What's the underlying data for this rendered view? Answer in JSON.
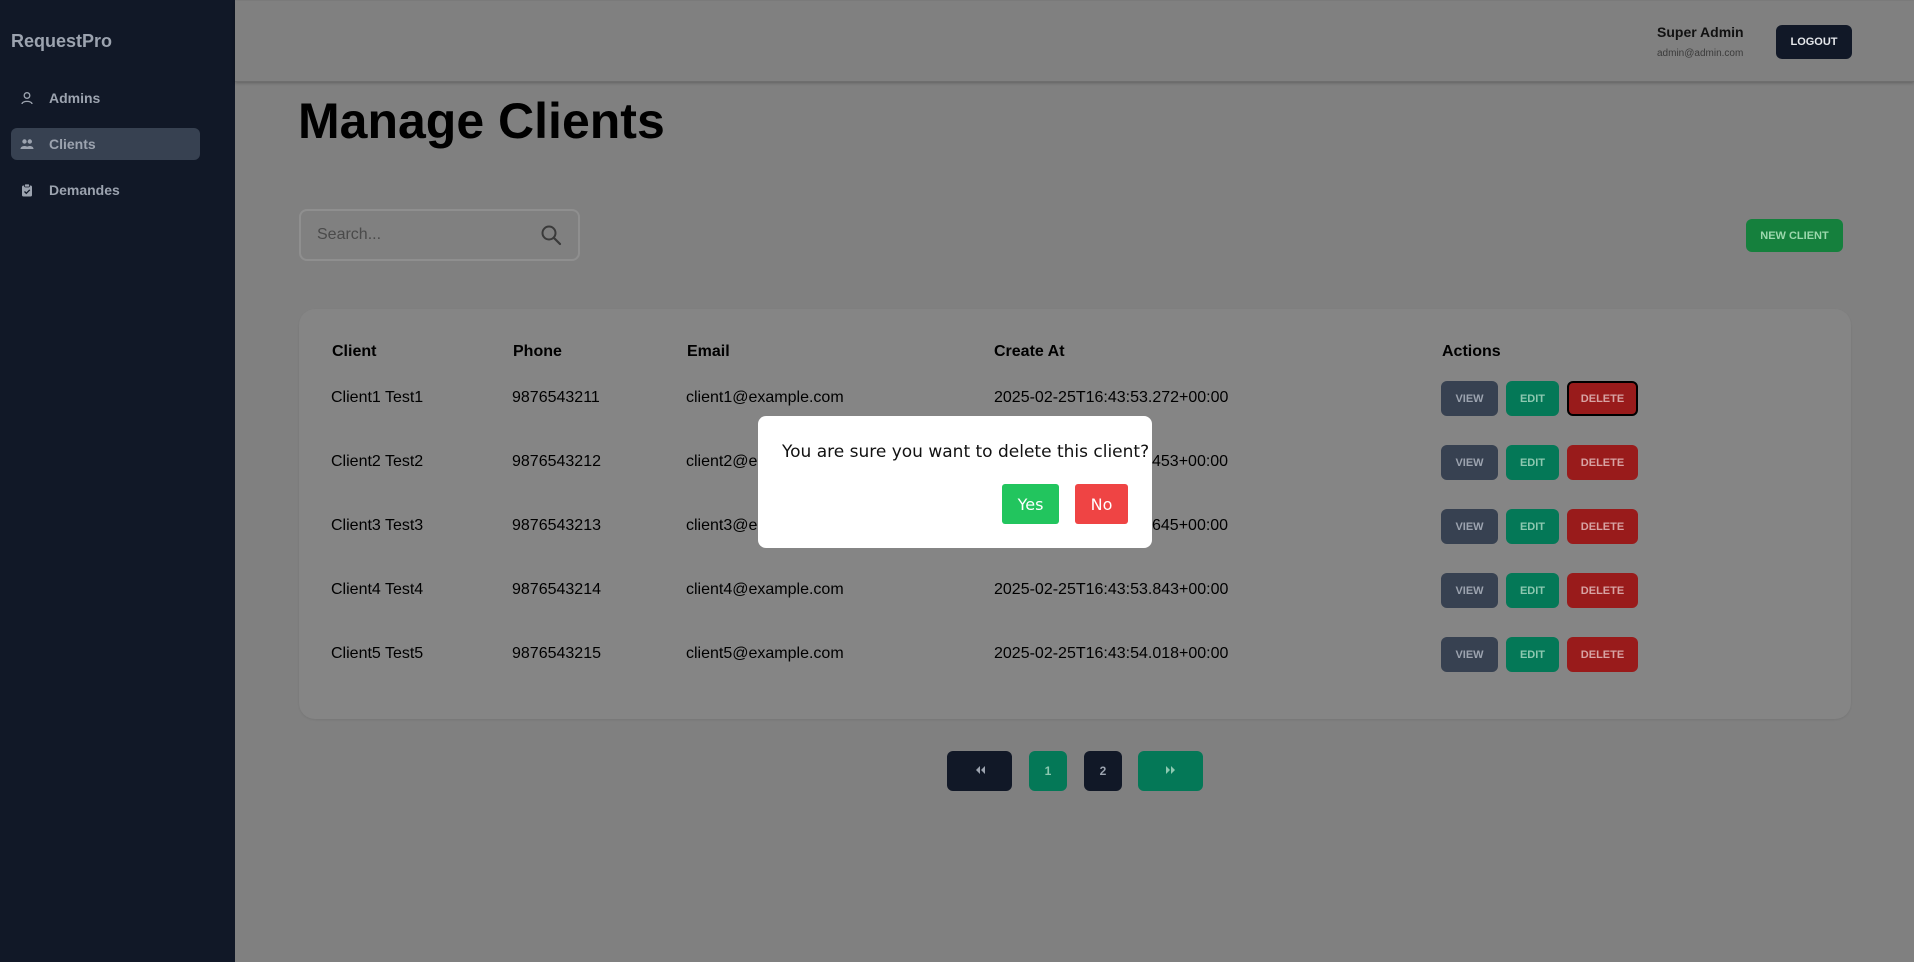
{
  "sidebar": {
    "brand": "RequestPro",
    "items": [
      {
        "label": "Admins",
        "icon": "user-icon",
        "active": false
      },
      {
        "label": "Clients",
        "icon": "users-icon",
        "active": true
      },
      {
        "label": "Demandes",
        "icon": "clipboard-icon",
        "active": false
      }
    ]
  },
  "header": {
    "user_name": "Super Admin",
    "user_email": "admin@admin.com",
    "logout_label": "LOGOUT"
  },
  "main": {
    "title": "Manage Clients",
    "search_placeholder": "Search...",
    "new_client_label": "NEW CLIENT"
  },
  "table": {
    "headers": [
      "Client",
      "Phone",
      "Email",
      "Create At",
      "Actions"
    ],
    "rows": [
      {
        "client": "Client1 Test1",
        "phone": "9876543211",
        "email": "client1@example.com",
        "created": "2025-02-25T16:43:53.272+00:00"
      },
      {
        "client": "Client2 Test2",
        "phone": "9876543212",
        "email": "client2@e",
        "created": "453+00:00"
      },
      {
        "client": "Client3 Test3",
        "phone": "9876543213",
        "email": "client3@e",
        "created": "645+00:00"
      },
      {
        "client": "Client4 Test4",
        "phone": "9876543214",
        "email": "client4@example.com",
        "created": "2025-02-25T16:43:53.843+00:00"
      },
      {
        "client": "Client5 Test5",
        "phone": "9876543215",
        "email": "client5@example.com",
        "created": "2025-02-25T16:43:54.018+00:00"
      }
    ],
    "actions": {
      "view": "VIEW",
      "edit": "EDIT",
      "delete": "DELETE"
    }
  },
  "pagination": {
    "first_icon": "double-chevron-left-icon",
    "pages": [
      "1",
      "2"
    ],
    "current_page": "1",
    "last_icon": "double-chevron-right-icon"
  },
  "modal": {
    "message": "You are sure you want to delete this client?",
    "yes_label": "Yes",
    "no_label": "No"
  },
  "colors": {
    "sidebar_bg": "#111827",
    "overlay_bg": "#808080",
    "view": "#374151",
    "edit": "#047857",
    "delete": "#991b1b",
    "new_client": "#15803d",
    "modal_yes": "#22c55e",
    "modal_no": "#ef4444"
  }
}
